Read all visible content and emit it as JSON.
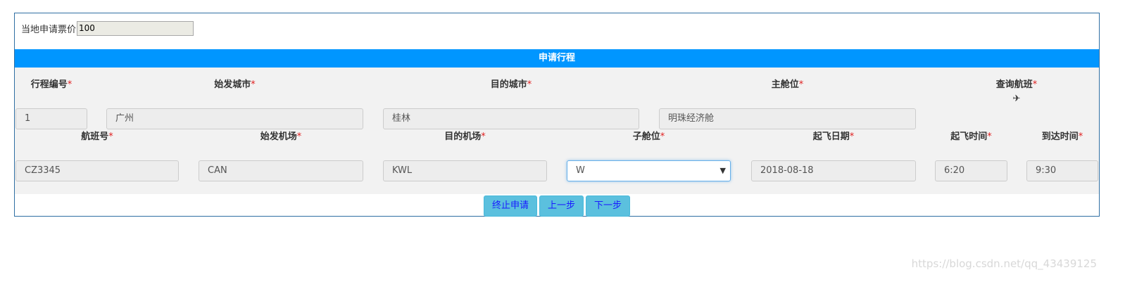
{
  "price": {
    "label": "当地申请票价",
    "value": "100"
  },
  "section_title": "申请行程",
  "row1": {
    "labels": [
      "行程编号",
      "始发城市",
      "目的城市",
      "主舱位",
      "查询航班"
    ],
    "values": [
      "1",
      "广州",
      "桂林",
      "明珠经济舱"
    ],
    "query_icon": "airplane-icon"
  },
  "row2": {
    "labels": [
      "航班号",
      "始发机场",
      "目的机场",
      "子舱位",
      "起飞日期",
      "起飞时间",
      "到达时间"
    ],
    "values": [
      "CZ3345",
      "CAN",
      "KWL",
      "W",
      "2018-08-18",
      "6:20",
      "9:30"
    ]
  },
  "required_mark": "*",
  "buttons": {
    "terminate": "终止申请",
    "prev": "上一步",
    "next": "下一步"
  },
  "watermark": "https://blog.csdn.net/qq_43439125",
  "colors": {
    "section_bar": "#0096ff",
    "button_bg": "#5bc0de",
    "required": "#e02020"
  }
}
